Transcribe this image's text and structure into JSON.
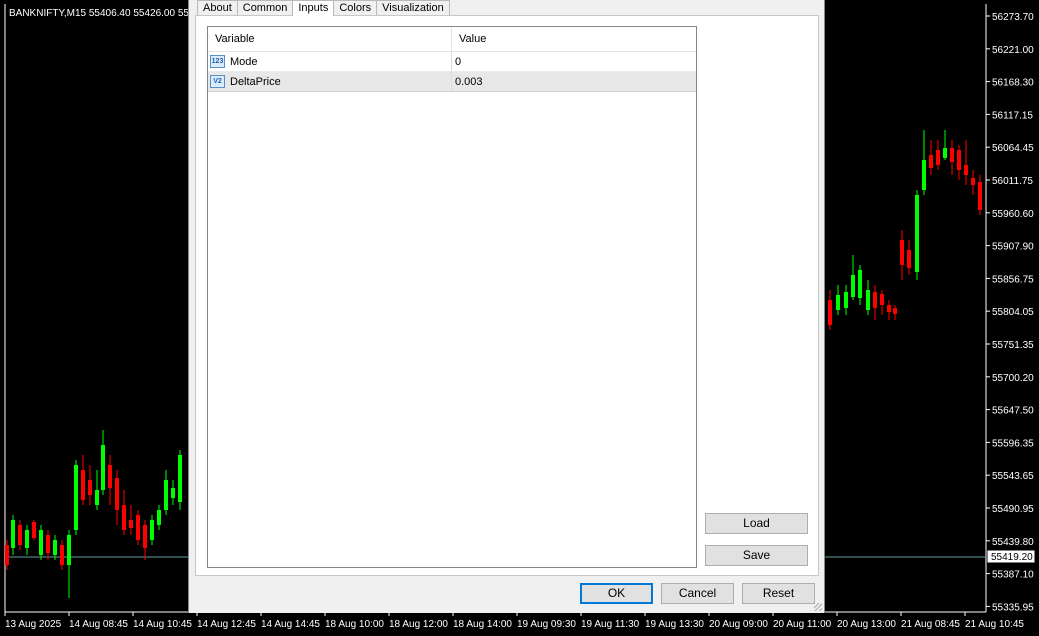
{
  "chart": {
    "title_text": "BANKNIFTY,M15  55406.40 55426.00 55",
    "current_price": "55419.20",
    "price_axis": [
      "56273.70",
      "56221.00",
      "56168.30",
      "56117.15",
      "56064.45",
      "56011.75",
      "55960.60",
      "55907.90",
      "55856.75",
      "55804.05",
      "55751.35",
      "55700.20",
      "55647.50",
      "55596.35",
      "55543.65",
      "55490.95",
      "55439.80",
      "55387.10",
      "55335.95"
    ],
    "time_axis": [
      "13 Aug 2025",
      "14 Aug 08:45",
      "14 Aug 10:45",
      "14 Aug 12:45",
      "14 Aug 14:45",
      "18 Aug 10:00",
      "18 Aug 12:00",
      "18 Aug 14:00",
      "19 Aug 09:30",
      "19 Aug 11:30",
      "19 Aug 13:30",
      "20 Aug 09:00",
      "20 Aug 11:00",
      "20 Aug 13:00",
      "21 Aug 08:45",
      "21 Aug 10:45"
    ],
    "colors": {
      "up": "#00ff00",
      "down": "#ff0000",
      "grid_text": "#ffffff",
      "price_line": "#5f9ea0"
    }
  },
  "dialog": {
    "tabs": [
      "About",
      "Common",
      "Inputs",
      "Colors",
      "Visualization"
    ],
    "active_tab": "Inputs",
    "table": {
      "headers": {
        "variable": "Variable",
        "value": "Value"
      },
      "rows": [
        {
          "icon": "integer-icon",
          "icon_text": "123",
          "variable": "Mode",
          "value": "0"
        },
        {
          "icon": "double-icon",
          "icon_text": "V2",
          "variable": "DeltaPrice",
          "value": "0.003"
        }
      ]
    },
    "buttons": {
      "load": "Load",
      "save": "Save",
      "ok": "OK",
      "cancel": "Cancel",
      "reset": "Reset"
    }
  }
}
